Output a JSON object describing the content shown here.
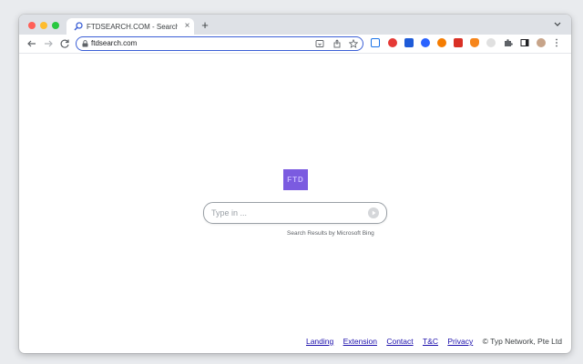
{
  "browser": {
    "tab": {
      "title": "FTDSEARCH.COM - Search An",
      "close": "×"
    },
    "new_tab": "+",
    "address": "ftdsearch.com",
    "extension_icons": [
      "ad-blocker-icon",
      "red-extension-icon",
      "blue-face-extension-icon",
      "blue-circle-extension-icon",
      "orange-extension-icon",
      "red-box-extension-icon",
      "metamask-fox-icon",
      "bug-extension-icon",
      "puzzle-icon",
      "sidebar-icon",
      "profile-avatar"
    ]
  },
  "page": {
    "logo_text": "FTD",
    "search": {
      "placeholder": "Type in ..."
    },
    "powered_by": "Search Results by Microsoft Bing",
    "footer": {
      "links": [
        "Landing",
        "Extension",
        "Contact",
        "T&C",
        "Privacy"
      ],
      "copyright": "© Typ Network, Pte Ltd"
    }
  },
  "colors": {
    "logo_bg": "#7b5be0",
    "omnibox_border": "#3b5fd6",
    "link": "#1a0dab"
  }
}
